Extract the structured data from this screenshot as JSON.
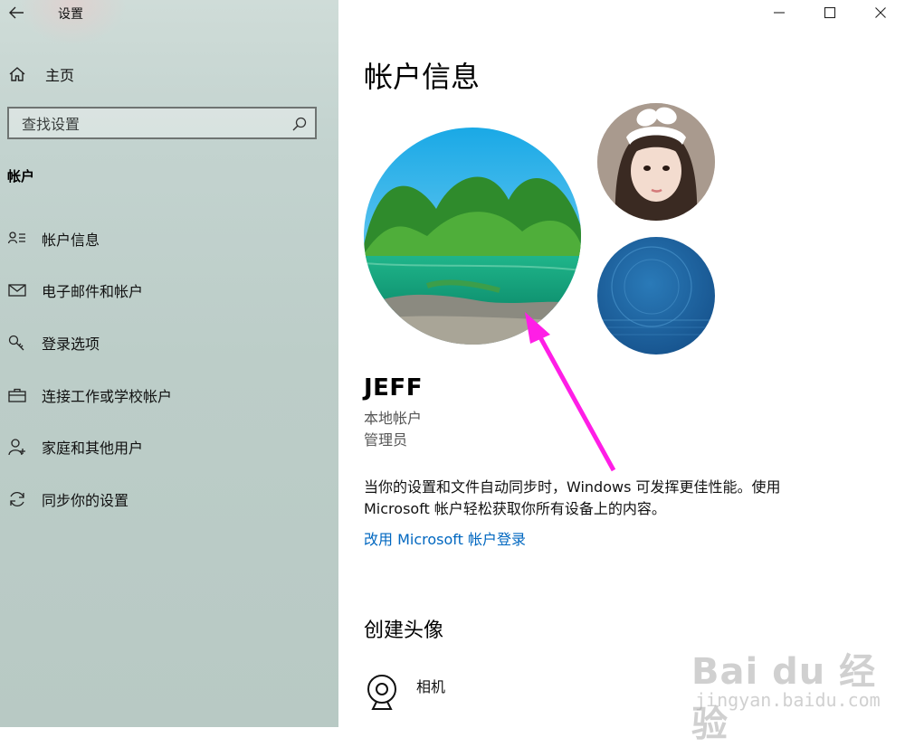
{
  "window": {
    "title": "设置"
  },
  "sidebar": {
    "home_label": "主页",
    "search_placeholder": "查找设置",
    "section": "帐户",
    "items": [
      {
        "label": "帐户信息",
        "icon": "person-list-icon"
      },
      {
        "label": "电子邮件和帐户",
        "icon": "mail-icon"
      },
      {
        "label": "登录选项",
        "icon": "key-icon"
      },
      {
        "label": "连接工作或学校帐户",
        "icon": "briefcase-icon"
      },
      {
        "label": "家庭和其他用户",
        "icon": "person-add-icon"
      },
      {
        "label": "同步你的设置",
        "icon": "sync-icon"
      }
    ]
  },
  "main": {
    "title": "帐户信息",
    "user": {
      "name": "JEFF",
      "account_type": "本地帐户",
      "role": "管理员"
    },
    "description": "当你的设置和文件自动同步时，Windows 可发挥更佳性能。使用 Microsoft 帐户轻松获取你所有设备上的内容。",
    "ms_signin_link": "改用 Microsoft 帐户登录",
    "create_avatar_title": "创建头像",
    "camera_label": "相机"
  },
  "watermark": {
    "brand": "Bai du 经验",
    "url": "jingyan.baidu.com"
  },
  "colors": {
    "link": "#0067c0",
    "annotation_arrow": "#ff1ee6",
    "sidebar_bg": "#bccdc8"
  }
}
